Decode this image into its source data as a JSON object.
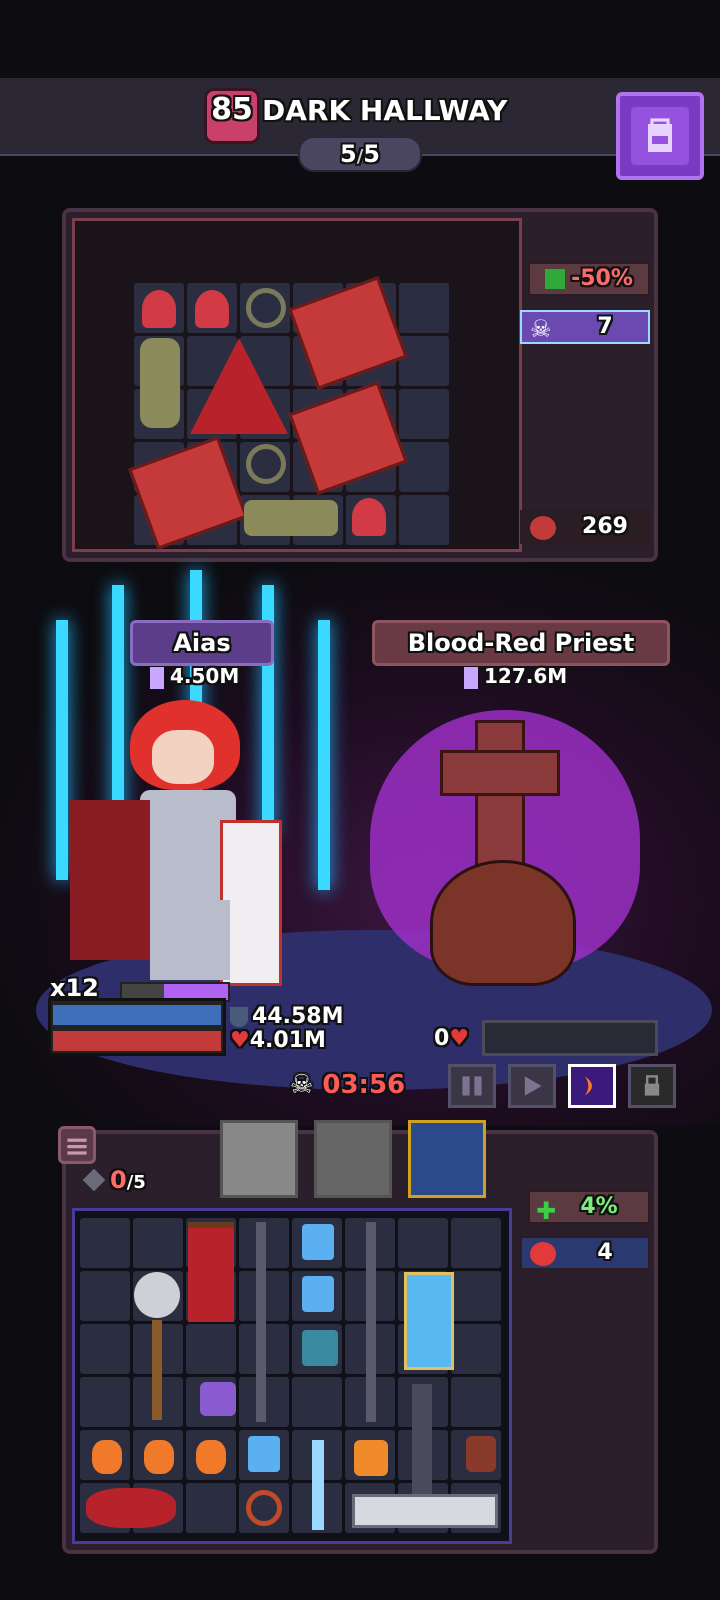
{
  "header": {
    "level": "85",
    "stage_name": "DARK HALLWAY",
    "wave_current": "5",
    "wave_separator": "/",
    "wave_total": "5",
    "bag_icon": "backpack-icon"
  },
  "enemy_panel": {
    "debuff_value": "-50%",
    "skull_count": "7",
    "gold_value": "269"
  },
  "battle": {
    "hero_name": "Aias",
    "hero_power": "4.50M",
    "enemy_name": "Blood-Red Priest",
    "enemy_power": "127.6M",
    "combo_multiplier": "x12",
    "hero_shield": "44.58M",
    "hero_hp": "4.01M",
    "enemy_hp": "0",
    "timer": "03:56",
    "enemy_hp_fill": 0,
    "hero_hp_fill": 1.0
  },
  "player_panel": {
    "slots_used": "0",
    "slots_total": "/5",
    "heal_bonus": "4%",
    "monster_count": "4"
  },
  "colors": {
    "accent_purple": "#7a3bc2",
    "hp_red": "#c23a3a",
    "sword_cyan": "#3ad9ff"
  }
}
